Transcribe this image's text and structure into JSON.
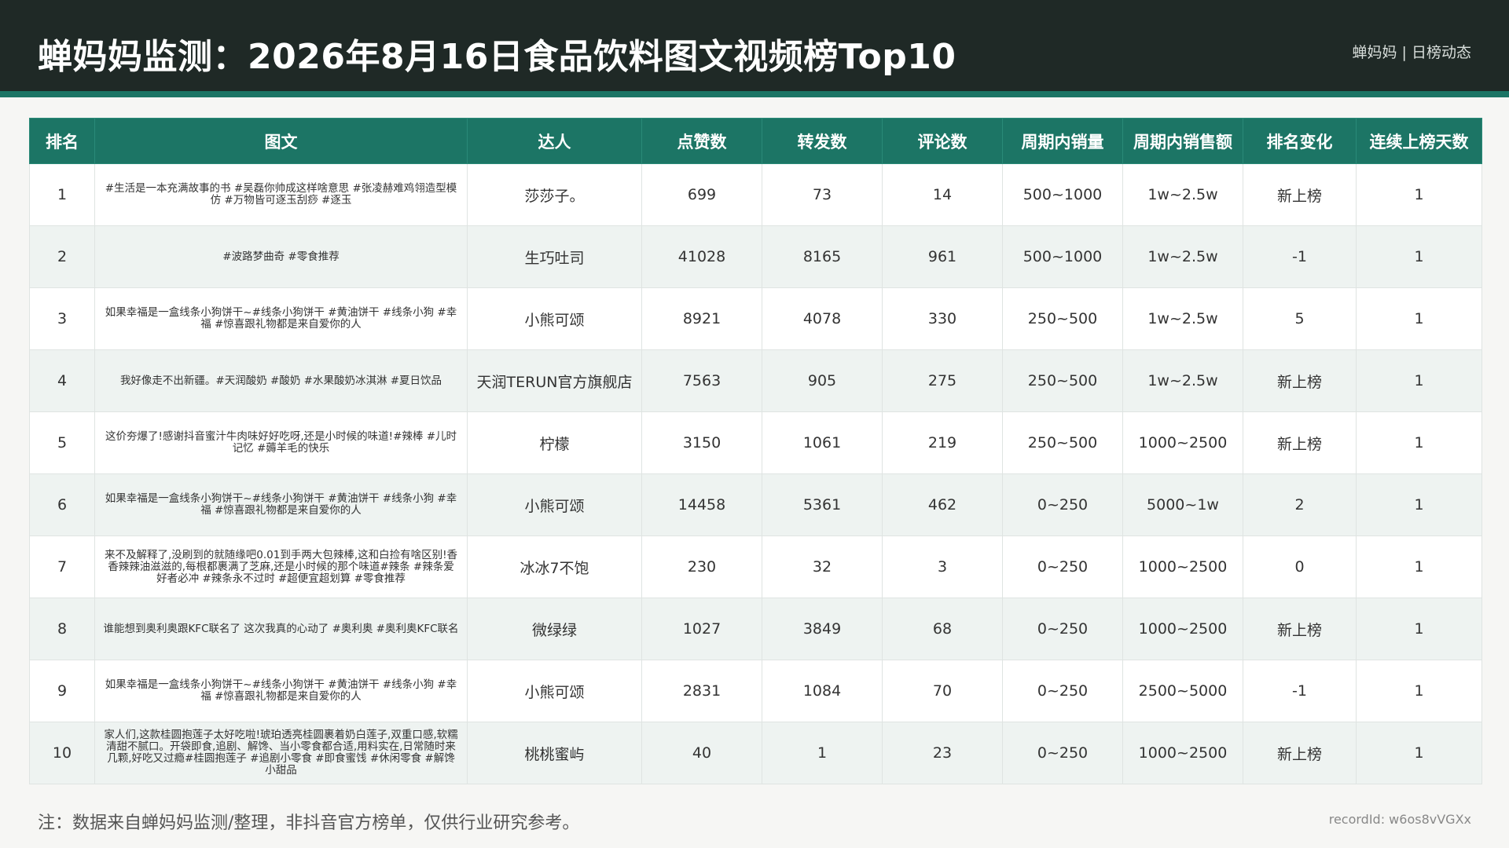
{
  "header": {
    "title": "蝉妈妈监测：2026年8月16日食品饮料图文视频榜Top10",
    "brand": "蝉妈妈 | 日榜动态"
  },
  "table": {
    "columns": [
      "排名",
      "图文",
      "达人",
      "点赞数",
      "转发数",
      "评论数",
      "周期内销量",
      "周期内销售额",
      "排名变化",
      "连续上榜天数"
    ],
    "rows": [
      {
        "rank": "1",
        "post": "#生活是一本充满故事的书 #吴磊你帅成这样啥意思 #张凌赫难鸡翎造型模仿 #万物皆可逐玉刮痧 #逐玉",
        "author": "莎莎子。",
        "likes": "699",
        "shares": "73",
        "comments": "14",
        "sales": "500~1000",
        "revenue": "1w~2.5w",
        "change": "新上榜",
        "days": "1"
      },
      {
        "rank": "2",
        "post": "#波路梦曲奇 #零食推荐",
        "author": "生巧吐司",
        "likes": "41028",
        "shares": "8165",
        "comments": "961",
        "sales": "500~1000",
        "revenue": "1w~2.5w",
        "change": "-1",
        "days": "1"
      },
      {
        "rank": "3",
        "post": "如果幸福是一盒线条小狗饼干~#线条小狗饼干 #黄油饼干 #线条小狗 #幸福 #惊喜跟礼物都是来自爱你的人",
        "author": "小熊可颂",
        "likes": "8921",
        "shares": "4078",
        "comments": "330",
        "sales": "250~500",
        "revenue": "1w~2.5w",
        "change": "5",
        "days": "1"
      },
      {
        "rank": "4",
        "post": "我好像走不出新疆。#天润酸奶 #酸奶 #水果酸奶冰淇淋 #夏日饮品",
        "author": "天润TERUN官方旗舰店",
        "likes": "7563",
        "shares": "905",
        "comments": "275",
        "sales": "250~500",
        "revenue": "1w~2.5w",
        "change": "新上榜",
        "days": "1"
      },
      {
        "rank": "5",
        "post": "这价夯爆了!感谢抖音蜜汁牛肉味好好吃呀,还是小时候的味道!#辣棒 #儿时记忆 #薅羊毛的快乐",
        "author": "柠檬",
        "likes": "3150",
        "shares": "1061",
        "comments": "219",
        "sales": "250~500",
        "revenue": "1000~2500",
        "change": "新上榜",
        "days": "1"
      },
      {
        "rank": "6",
        "post": "如果幸福是一盒线条小狗饼干~#线条小狗饼干 #黄油饼干 #线条小狗 #幸福 #惊喜跟礼物都是来自爱你的人",
        "author": "小熊可颂",
        "likes": "14458",
        "shares": "5361",
        "comments": "462",
        "sales": "0~250",
        "revenue": "5000~1w",
        "change": "2",
        "days": "1"
      },
      {
        "rank": "7",
        "post": "来不及解释了,没刷到的就随缘吧0.01到手两大包辣棒,这和白捡有啥区别!香香辣辣油滋滋的,每根都裹满了芝麻,还是小时候的那个味道#辣条 #辣条爱好者必冲 #辣条永不过时 #超便宜超划算 #零食推荐",
        "author": "冰冰7不饱",
        "likes": "230",
        "shares": "32",
        "comments": "3",
        "sales": "0~250",
        "revenue": "1000~2500",
        "change": "0",
        "days": "1"
      },
      {
        "rank": "8",
        "post": "谁能想到奥利奥跟KFC联名了 这次我真的心动了 #奥利奥 #奥利奥KFC联名",
        "author": "微绿绿",
        "likes": "1027",
        "shares": "3849",
        "comments": "68",
        "sales": "0~250",
        "revenue": "1000~2500",
        "change": "新上榜",
        "days": "1"
      },
      {
        "rank": "9",
        "post": "如果幸福是一盒线条小狗饼干~#线条小狗饼干 #黄油饼干 #线条小狗 #幸福 #惊喜跟礼物都是来自爱你的人",
        "author": "小熊可颂",
        "likes": "2831",
        "shares": "1084",
        "comments": "70",
        "sales": "0~250",
        "revenue": "2500~5000",
        "change": "-1",
        "days": "1"
      },
      {
        "rank": "10",
        "post": "家人们,这款桂圆抱莲子太好吃啦!琥珀透亮桂圆裹着奶白莲子,双重口感,软糯清甜不腻口。开袋即食,追剧、解馋、当小零食都合适,用料实在,日常随时来几颗,好吃又过瘾#桂圆抱莲子 #追剧小零食 #即食蜜饯 #休闲零食 #解馋小甜品",
        "author": "桃桃蜜屿",
        "likes": "40",
        "shares": "1",
        "comments": "23",
        "sales": "0~250",
        "revenue": "1000~2500",
        "change": "新上榜",
        "days": "1"
      }
    ]
  },
  "footer": {
    "note": "注：数据来自蝉妈妈监测/整理，非抖音官方榜单，仅供行业研究参考。",
    "record_id": "recordId: w6os8vVGXx"
  }
}
